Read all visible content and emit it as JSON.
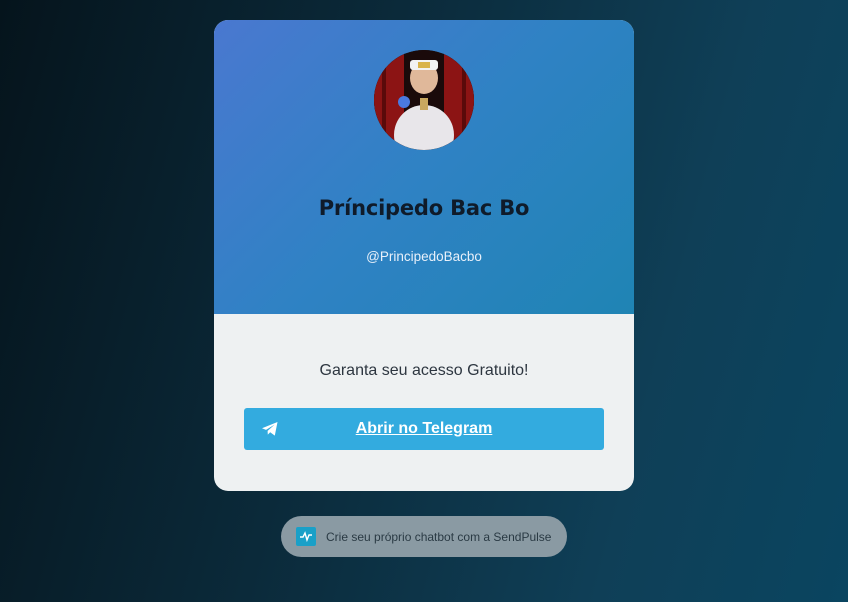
{
  "profile": {
    "name": "Príncipedo Bac Bo",
    "handle": "@PrincipedoBacbo"
  },
  "body": {
    "cta_text": "Garanta seu acesso Gratuito!",
    "telegram_button_label": "Abrir no Telegram"
  },
  "footer": {
    "sendpulse_text": "Crie seu próprio chatbot com a SendPulse"
  },
  "colors": {
    "header_gradient_start": "#4a78d0",
    "header_gradient_end": "#1f84b4",
    "telegram_button": "#33abdf",
    "card_body": "#eef1f2"
  },
  "icons": {
    "telegram": "telegram-plane-icon",
    "sendpulse": "pulse-icon"
  }
}
